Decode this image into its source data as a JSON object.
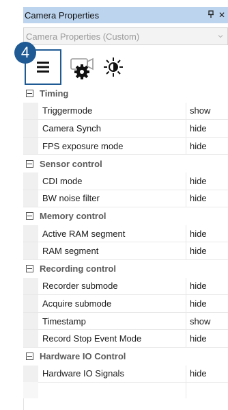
{
  "panel": {
    "title": "Camera Properties",
    "pin_glyph": "ᵽ",
    "close_glyph": "✕"
  },
  "combo": {
    "value": "Camera Properties (Custom)"
  },
  "badge": {
    "number": "4"
  },
  "toolbar": {
    "icons": [
      "list-icon",
      "camera-gear-icon",
      "brightness-icon"
    ],
    "accent": "#1f5a94"
  },
  "sections": [
    {
      "name": "Timing",
      "rows": [
        {
          "name": "Triggermode",
          "value": "show"
        },
        {
          "name": "Camera Synch",
          "value": "hide"
        },
        {
          "name": "FPS exposure mode",
          "value": "hide"
        }
      ]
    },
    {
      "name": "Sensor control",
      "rows": [
        {
          "name": "CDI mode",
          "value": "hide"
        },
        {
          "name": "BW noise filter",
          "value": "hide"
        }
      ]
    },
    {
      "name": "Memory control",
      "rows": [
        {
          "name": "Active RAM segment",
          "value": "hide"
        },
        {
          "name": "RAM segment",
          "value": "hide"
        }
      ]
    },
    {
      "name": "Recording control",
      "rows": [
        {
          "name": "Recorder submode",
          "value": "hide"
        },
        {
          "name": "Acquire submode",
          "value": "hide"
        },
        {
          "name": "Timestamp",
          "value": "show"
        },
        {
          "name": "Record Stop Event Mode",
          "value": "hide"
        }
      ]
    },
    {
      "name": "Hardware IO Control",
      "rows": [
        {
          "name": "Hardware IO Signals",
          "value": "hide"
        }
      ]
    }
  ]
}
